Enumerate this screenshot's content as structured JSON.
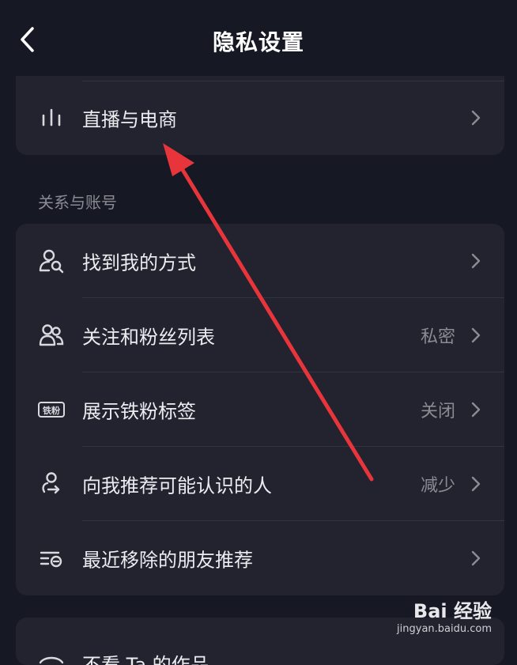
{
  "header": {
    "title": "隐私设置",
    "back_icon": "chevron-left-icon"
  },
  "top_card": {
    "item": {
      "label": "直播与电商",
      "icon": "bar-chart-icon"
    }
  },
  "section": {
    "title": "关系与账号"
  },
  "items": [
    {
      "label": "找到我的方式",
      "value": "",
      "icon": "person-search-icon"
    },
    {
      "label": "关注和粉丝列表",
      "value": "私密",
      "icon": "people-icon"
    },
    {
      "label": "展示铁粉标签",
      "value": "关闭",
      "icon": "iron-fan-badge-icon",
      "badge_text": "铁粉"
    },
    {
      "label": "向我推荐可能认识的人",
      "value": "减少",
      "icon": "person-recommend-icon"
    },
    {
      "label": "最近移除的朋友推荐",
      "value": "",
      "icon": "list-remove-icon"
    }
  ],
  "bottom_card": {
    "label": "不看 Ta 的作品"
  },
  "watermark": {
    "logo": "Bai 经验",
    "url": "jingyan.baidu.com"
  },
  "colors": {
    "background": "#161823",
    "card": "#22232e",
    "arrow": "#e8353b",
    "muted": "#8a8b93"
  }
}
